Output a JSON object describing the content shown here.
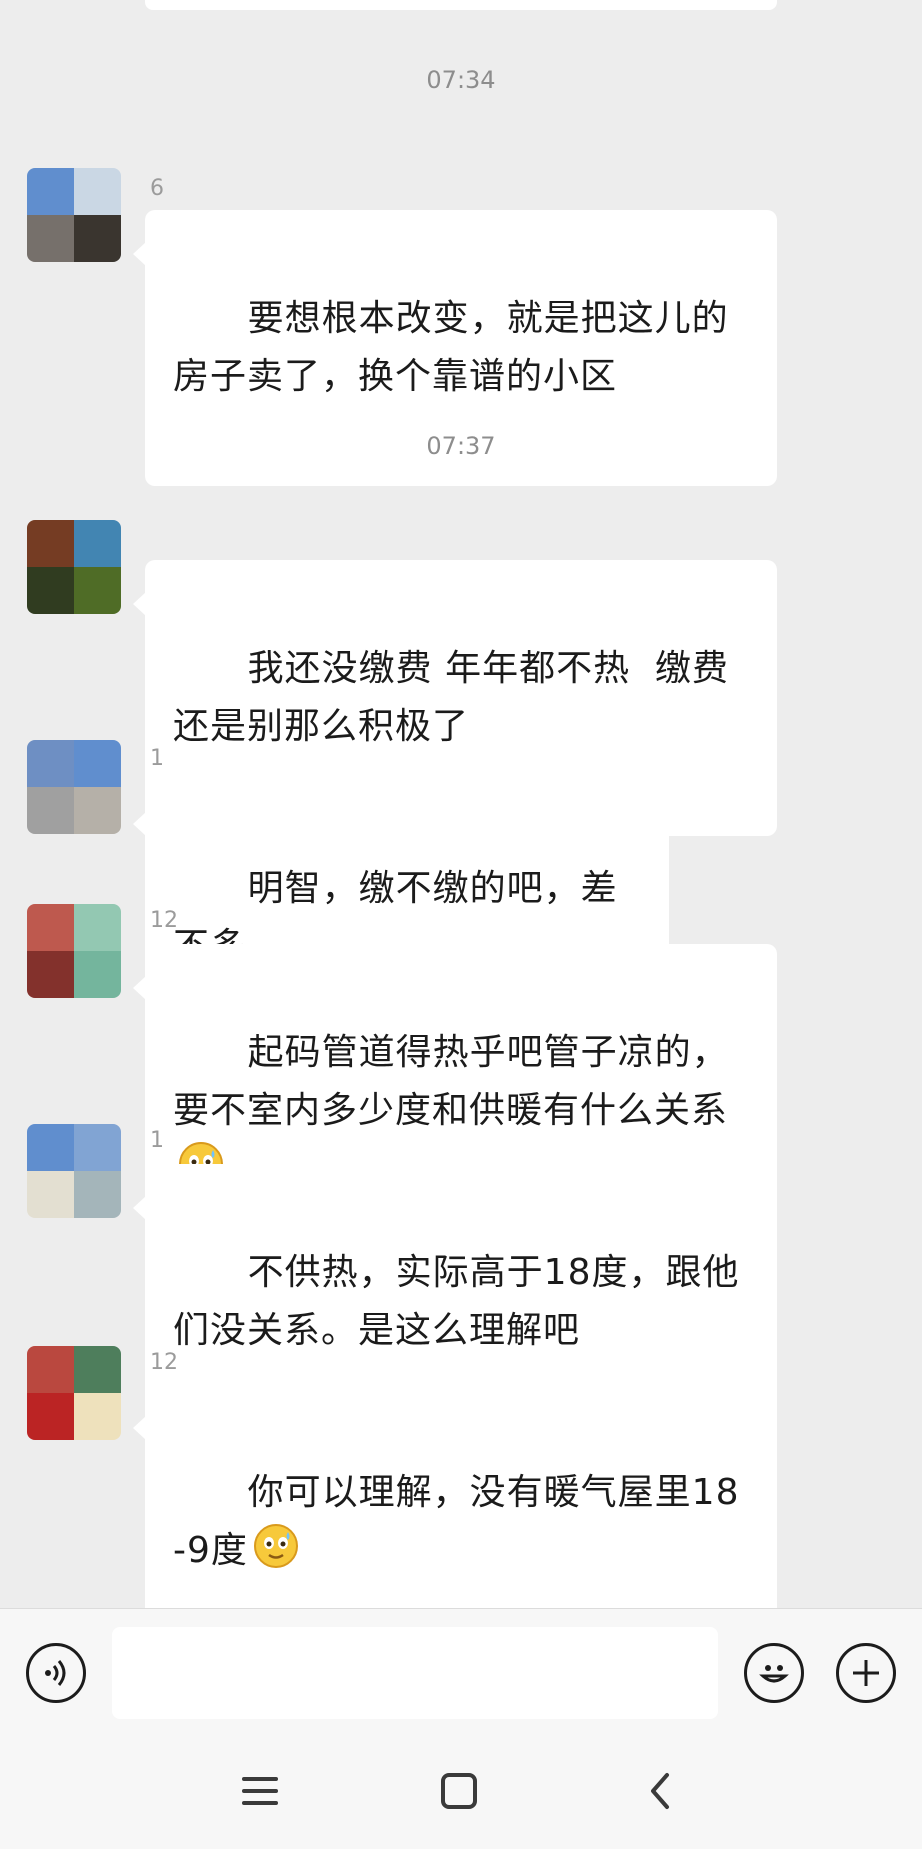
{
  "chat": {
    "time_separators": [
      "07:34",
      "07:37"
    ],
    "messages": [
      {
        "sender": "6",
        "text": "要想根本改变，就是把这儿的房子卖了，换个靠谱的小区",
        "emoji": null
      },
      {
        "sender": "",
        "text": "我还没缴费 年年都不热  缴费还是别那么积极了",
        "emoji": null
      },
      {
        "sender": "1",
        "text": "明智，缴不缴的吧，差不多",
        "emoji": null
      },
      {
        "sender": "12",
        "text": "起码管道得热乎吧管子凉的，要不室内多少度和供暖有什么关系",
        "emoji": "awkward-smile-emoji"
      },
      {
        "sender": "1",
        "text": "不供热，实际高于18度，跟他们没关系。是这么理解吧",
        "emoji": null
      },
      {
        "sender": "12",
        "text": "你可以理解，没有暖气屋里18-9度",
        "emoji": "awkward-smile-emoji"
      }
    ]
  },
  "input_bar": {
    "voice_icon": "voice-icon",
    "message_value": "",
    "emoji_icon": "smiley-icon",
    "plus_icon": "plus-icon"
  },
  "nav_bar": {
    "menu_icon": "menu-icon",
    "home_icon": "home-square-icon",
    "back_icon": "back-chevron-icon"
  },
  "colors": {
    "background": "#ededed",
    "bubble": "#ffffff",
    "timestamp": "#8d8d8d",
    "text": "#1b1b1b"
  }
}
